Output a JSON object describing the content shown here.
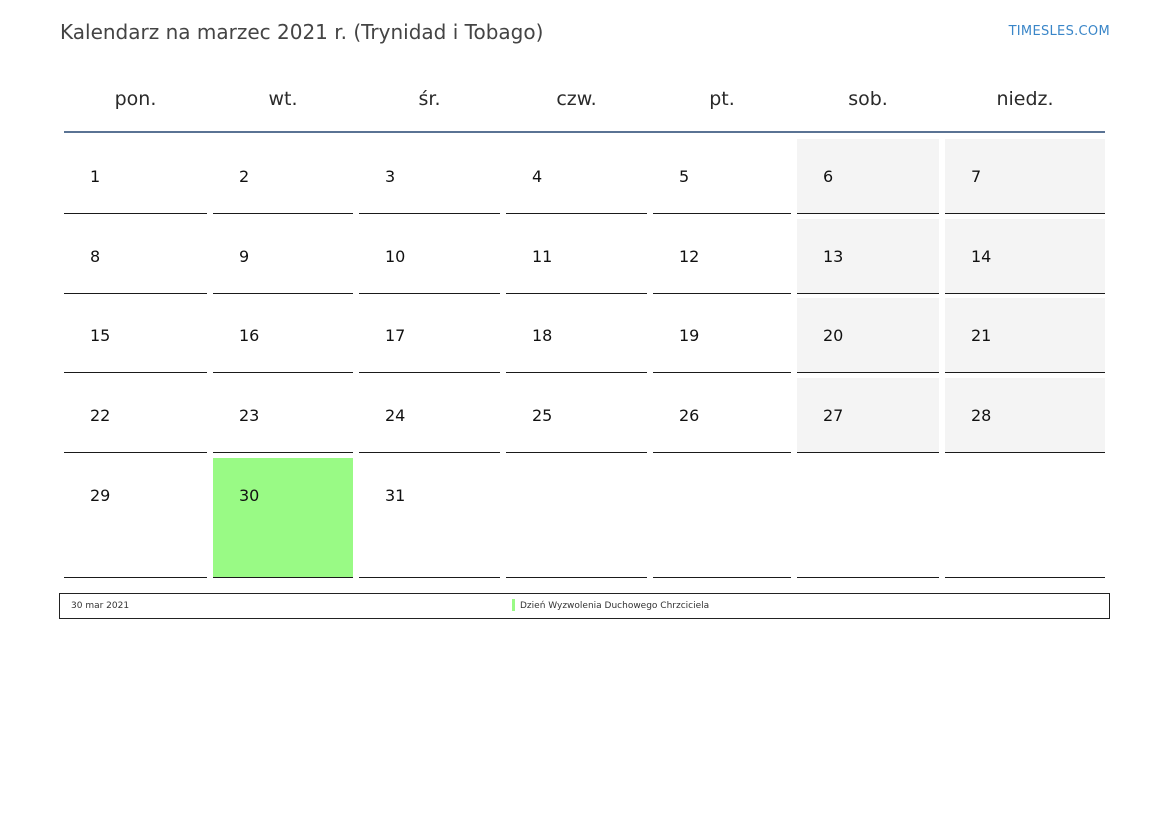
{
  "header": {
    "title": "Kalendarz na marzec 2021 r. (Trynidad i Tobago)",
    "site": "TIMESLES.COM"
  },
  "calendar": {
    "weekdays": [
      "pon.",
      "wt.",
      "śr.",
      "czw.",
      "pt.",
      "sob.",
      "niedz."
    ],
    "weeks": [
      [
        "1",
        "2",
        "3",
        "4",
        "5",
        "6",
        "7"
      ],
      [
        "8",
        "9",
        "10",
        "11",
        "12",
        "13",
        "14"
      ],
      [
        "15",
        "16",
        "17",
        "18",
        "19",
        "20",
        "21"
      ],
      [
        "22",
        "23",
        "24",
        "25",
        "26",
        "27",
        "28"
      ],
      [
        "29",
        "30",
        "31",
        "",
        "",
        "",
        ""
      ]
    ],
    "holiday_day": "30"
  },
  "legend": {
    "date": "30 mar 2021",
    "name": "Dzień Wyzwolenia Duchowego Chrzciciela",
    "color": "#99fa85"
  },
  "colors": {
    "weekend_bg": "#f4f4f4",
    "holiday_bg": "#99fa85",
    "header_rule": "#5a7394",
    "link": "#3a86c8"
  }
}
